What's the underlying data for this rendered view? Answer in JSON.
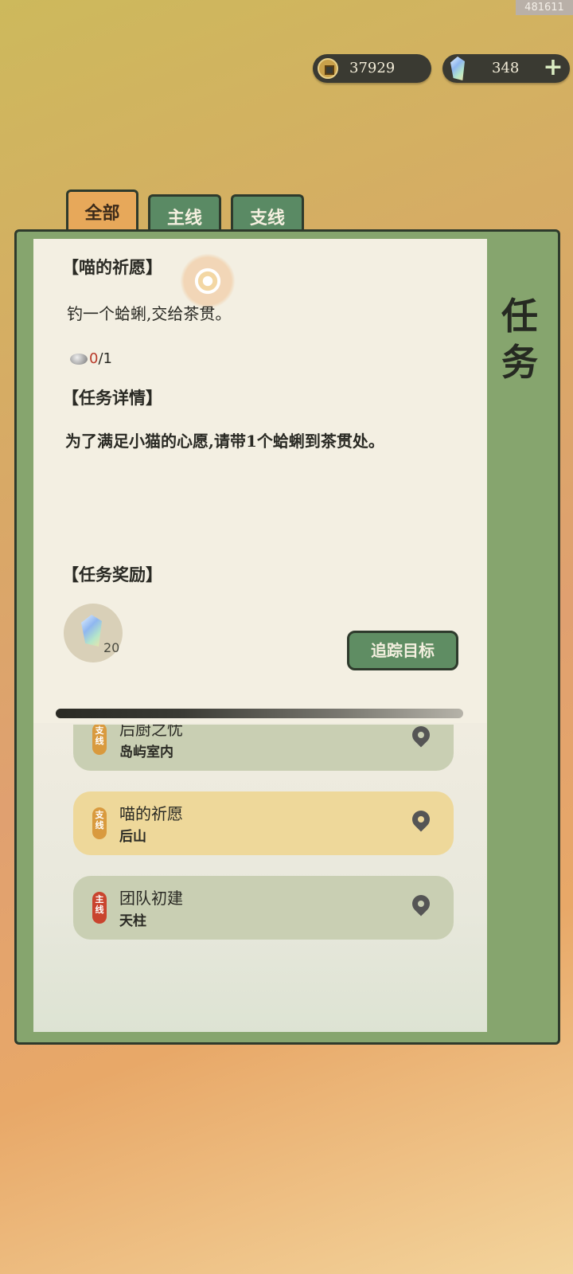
{
  "watermark": "481611",
  "currency": {
    "coins": "37929",
    "gems": "348",
    "coin_icon": "coin-icon",
    "gem_icon": "gem-icon"
  },
  "tabs": [
    {
      "label": "全部",
      "active": true
    },
    {
      "label": "主线",
      "active": false
    },
    {
      "label": "支线",
      "active": false
    }
  ],
  "side_title": {
    "line1": "任",
    "line2": "务"
  },
  "quest": {
    "title": "【喵的祈愿】",
    "objective": "钓一个蛤蜊,交给茶贯。",
    "progress_current": "0",
    "progress_total": "/1",
    "details_heading": "【任务详情】",
    "details_text": "为了满足小猫的心愿,请带1个蛤蜊到茶贯处。",
    "reward_heading": "【任务奖励】",
    "reward_count": "20",
    "track_button": "追踪目标"
  },
  "quest_list": [
    {
      "tag": "支线",
      "name": "后厨之忧",
      "location": "岛屿室内",
      "style": "grey",
      "tag_type": "side"
    },
    {
      "tag": "支线",
      "name": "喵的祈愿",
      "location": "后山",
      "style": "gold",
      "tag_type": "side"
    },
    {
      "tag": "主线",
      "name": "团队初建",
      "location": "天柱",
      "style": "grey",
      "tag_type": "main"
    }
  ],
  "colors": {
    "frame_green": "#86a56e",
    "tab_active": "#e7a85a",
    "button_green": "#5f8d63",
    "progress_red": "#b83a2a"
  }
}
